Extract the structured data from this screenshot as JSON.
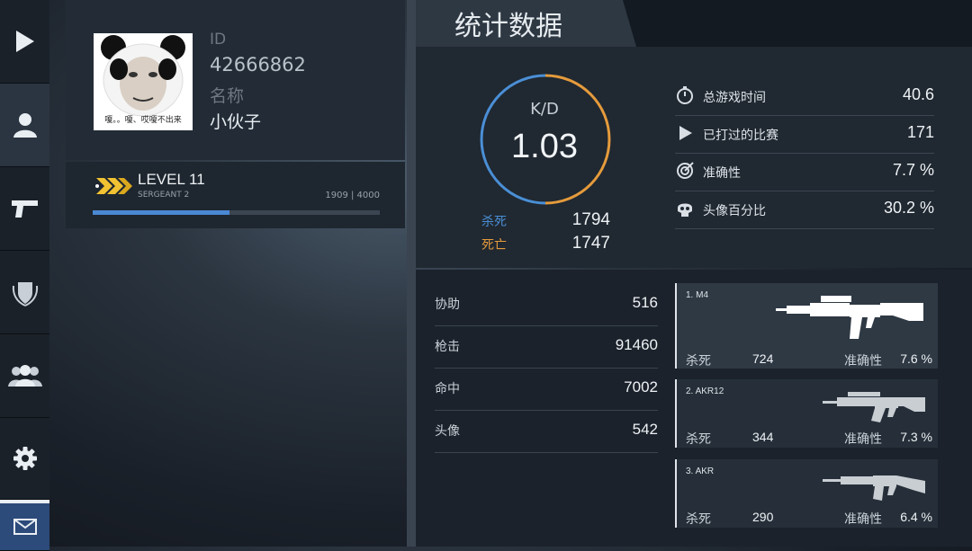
{
  "sidebar": {
    "items": [
      {
        "icon": "play-icon",
        "active": false
      },
      {
        "icon": "user-icon",
        "active": true
      },
      {
        "icon": "pistol-icon",
        "active": false
      },
      {
        "icon": "clan-shield-icon",
        "active": false
      },
      {
        "icon": "friends-icon",
        "active": false
      },
      {
        "icon": "gear-icon",
        "active": false
      },
      {
        "icon": "mail-icon",
        "active": false
      }
    ]
  },
  "profile": {
    "avatar_caption": "嗄。。嗄、哎嗄不出来",
    "id_label": "ID",
    "id_value": "42666862",
    "name_label": "名称",
    "name_value": "小伙子",
    "level_title": "LEVEL 11",
    "rank": "SERGEANT 2",
    "xp_text": "1909 | 4000",
    "xp_fraction": 0.477
  },
  "header": {
    "title": "统计数据"
  },
  "kd": {
    "label": "K/D",
    "value": "1.03",
    "kills_label": "杀死",
    "kills_value": "1794",
    "deaths_label": "死亡",
    "deaths_value": "1747"
  },
  "stats": [
    {
      "icon": "stopwatch-icon",
      "label": "总游戏时间",
      "value": "40.6"
    },
    {
      "icon": "play-triangle-icon",
      "label": "已打过的比赛",
      "value": "171"
    },
    {
      "icon": "target-icon",
      "label": "准确性",
      "value": "7.7 %"
    },
    {
      "icon": "headshot-skull-icon",
      "label": "头像百分比",
      "value": "30.2 %"
    }
  ],
  "combat": [
    {
      "label": "协助",
      "value": "516"
    },
    {
      "label": "枪击",
      "value": "91460"
    },
    {
      "label": "命中",
      "value": "7002"
    },
    {
      "label": "头像",
      "value": "542"
    }
  ],
  "weapons": [
    {
      "name": "1. M4",
      "kills_label": "杀死",
      "kills": "724",
      "acc_label": "准确性",
      "acc": "7.6 %"
    },
    {
      "name": "2. AKR12",
      "kills_label": "杀死",
      "kills": "344",
      "acc_label": "准确性",
      "acc": "7.3 %"
    },
    {
      "name": "3. AKR",
      "kills_label": "杀死",
      "kills": "290",
      "acc_label": "准确性",
      "acc": "6.4 %"
    }
  ],
  "colors": {
    "kills": "#4a8fd6",
    "deaths": "#e59b3c",
    "xp_bar": "#4a88d4",
    "level_chevrons": "#f1c232"
  }
}
